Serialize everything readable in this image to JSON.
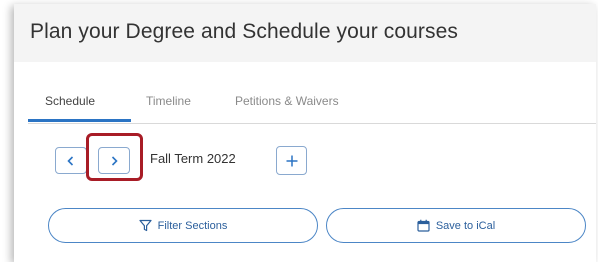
{
  "header": {
    "title": "Plan your Degree and Schedule your courses"
  },
  "tabs": [
    {
      "label": "Schedule",
      "active": true
    },
    {
      "label": "Timeline",
      "active": false
    },
    {
      "label": "Petitions & Waivers",
      "active": false
    }
  ],
  "term_nav": {
    "prev_icon": "chevron-left-icon",
    "next_icon": "chevron-right-icon",
    "term_label": "Fall Term 2022",
    "add_icon": "plus-icon"
  },
  "actions": {
    "filter_label": "Filter Sections",
    "filter_icon": "filter-icon",
    "ical_label": "Save to iCal",
    "ical_icon": "calendar-icon"
  },
  "colors": {
    "accent": "#2b74c4",
    "highlight": "#a81c26"
  }
}
